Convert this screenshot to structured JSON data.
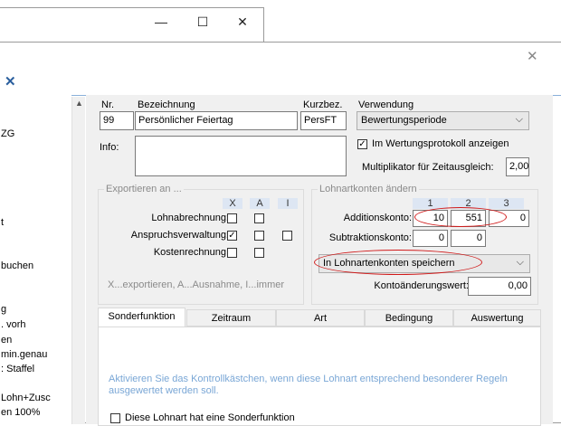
{
  "back_window": {
    "buttons": [
      "—",
      "☐",
      "✕"
    ]
  },
  "front_window": {
    "close_symbol": "✕",
    "toolbar_close": "✕"
  },
  "left_list": [
    "ZG",
    "t",
    "buchen",
    "g",
    ". vorh",
    "en",
    "min.genau",
    ": Staffel",
    "Lohn+Zusc",
    "en 100%"
  ],
  "fields": {
    "nr_label": "Nr.",
    "nr_value": "99",
    "bez_label": "Bezeichnung",
    "bez_value": "Persönlicher Feiertag",
    "kurz_label": "Kurzbez.",
    "kurz_value": "PersFT",
    "verw_label": "Verwendung",
    "verw_value": "Bewertungsperiode",
    "info_label": "Info:",
    "protokoll_label": "Im Wertungsprotokoll anzeigen",
    "protokoll_checked": true,
    "mult_label": "Multiplikator für Zeitausgleich:",
    "mult_value": "2,00"
  },
  "export_group": {
    "title": "Exportieren an ...",
    "col_headers": [
      "X",
      "A",
      "I"
    ],
    "rows": [
      {
        "label": "Lohnabrechnung:",
        "checks": [
          false,
          false
        ]
      },
      {
        "label": "Anspruchsverwaltung:",
        "checks": [
          true,
          false,
          false
        ]
      },
      {
        "label": "Kostenrechnung:",
        "checks": [
          false,
          false
        ]
      }
    ],
    "legend": "X...exportieren, A...Ausnahme, I...immer"
  },
  "konto_group": {
    "title": "Lohnartkonten ändern",
    "col_headers": [
      "1",
      "2",
      "3"
    ],
    "add_label": "Additionskonto:",
    "add_values": [
      "10",
      "551",
      "0"
    ],
    "sub_label": "Subtraktionskonto:",
    "sub_values": [
      "0",
      "0"
    ],
    "mode_value": "In Lohnartenkonten speichern",
    "change_label": "Kontoänderungswert:",
    "change_value": "0,00"
  },
  "tabs": [
    "Sonderfunktion",
    "Zeitraum",
    "Art",
    "Bedingung",
    "Auswertung"
  ],
  "sonder": {
    "info_text_1": "Aktivieren Sie das Kontrollkästchen, wenn diese Lohnart entsprechend besonderer Regeln",
    "info_text_2": "ausgewertet werden soll.",
    "checkbox_label": "Diese Lohnart hat eine Sonderfunktion",
    "checkbox_checked": false
  },
  "colors": {
    "accent_line": "#8ab0da",
    "highlight_oval": "#d01818",
    "info_text": "#7aa7d6"
  }
}
